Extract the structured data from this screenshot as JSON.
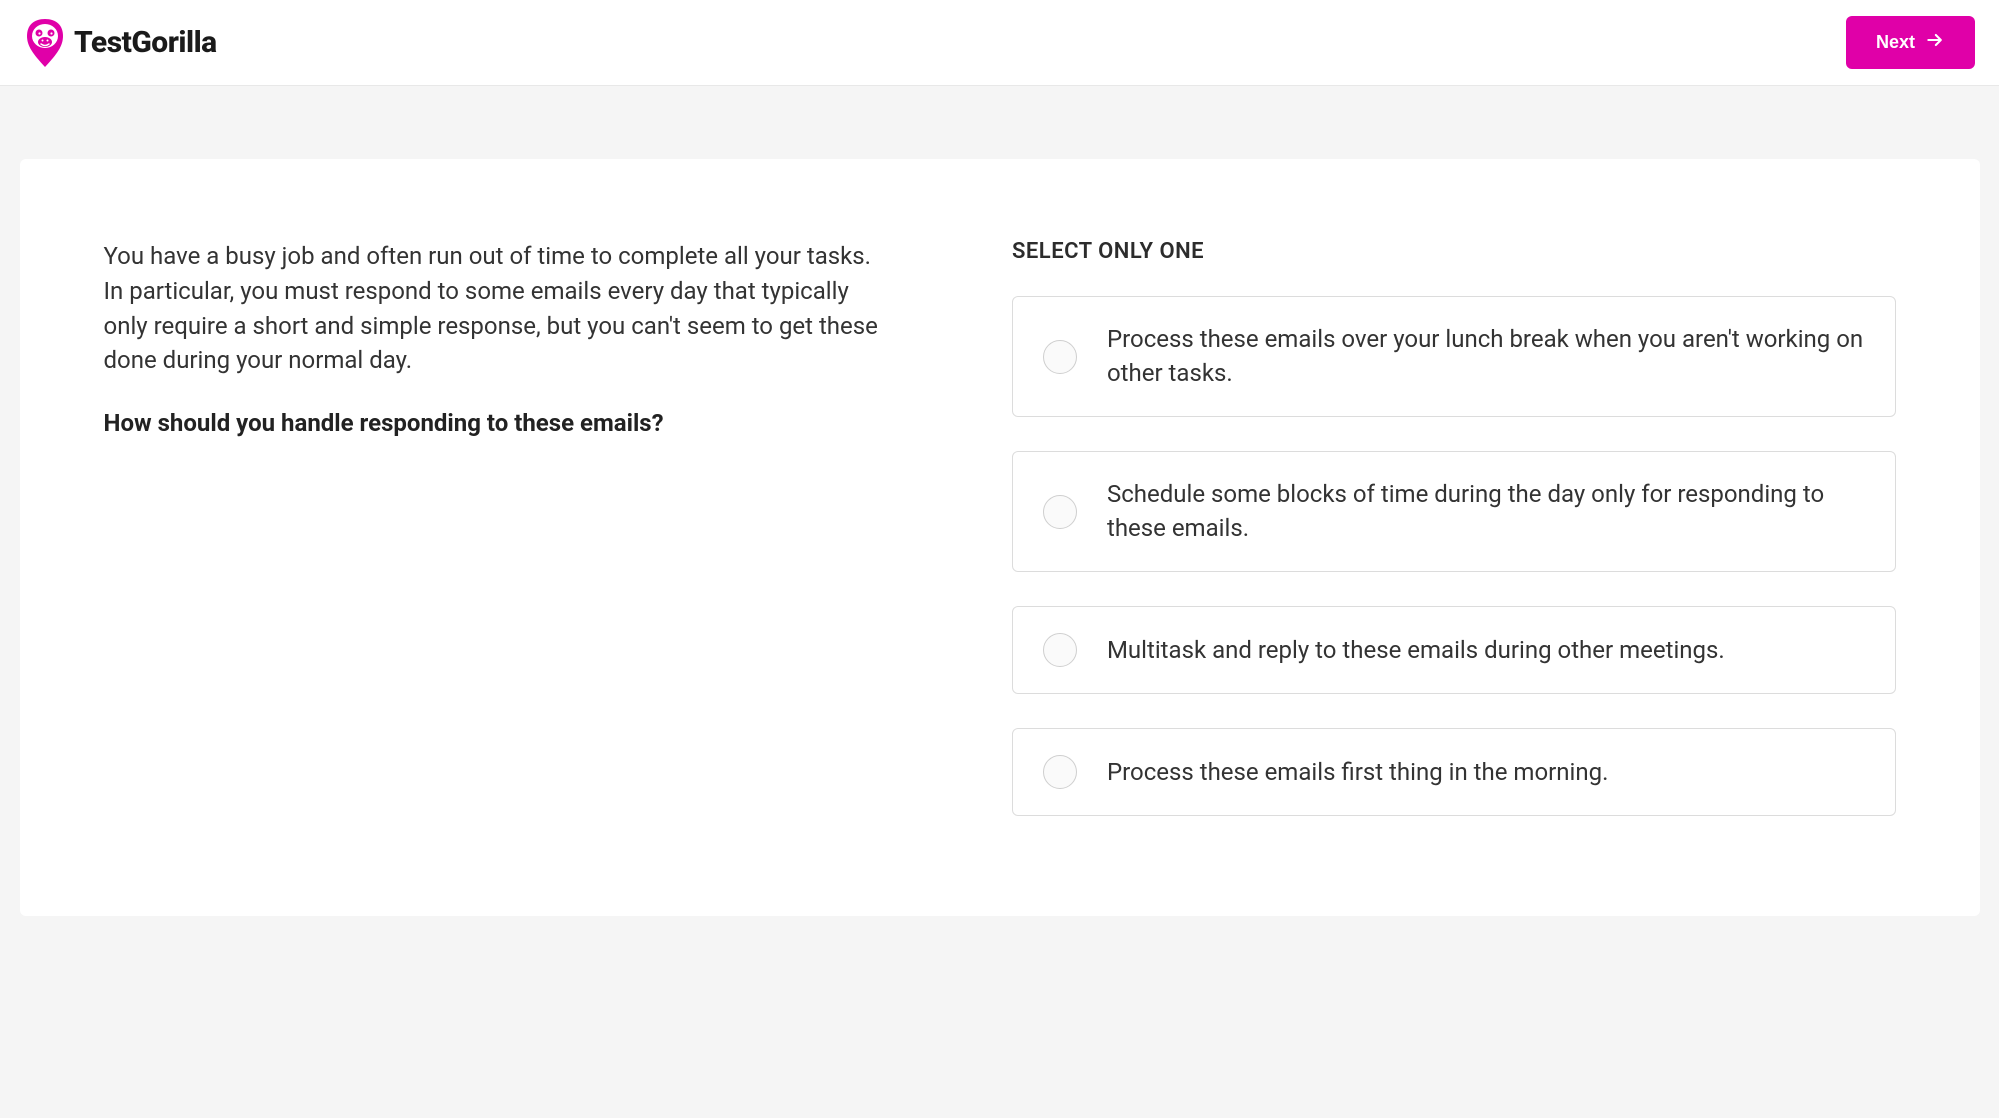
{
  "brand": {
    "name": "TestGorilla",
    "accent_color": "#e000a8"
  },
  "header": {
    "next_label": "Next"
  },
  "question": {
    "context": "You have a busy job and often run out of time to complete all your tasks. In particular, you must respond to some emails every day that typically only require a short and simple response, but you can't seem to get these done during your normal day.",
    "prompt": "How should you handle responding to these emails?",
    "instruction": "SELECT ONLY ONE",
    "options": [
      {
        "text": "Process these emails over your lunch break when you aren't working on other tasks."
      },
      {
        "text": "Schedule some blocks of time during the day only for responding to these emails."
      },
      {
        "text": "Multitask and reply to these emails during other meetings."
      },
      {
        "text": "Process these emails first thing in the morning."
      }
    ]
  }
}
